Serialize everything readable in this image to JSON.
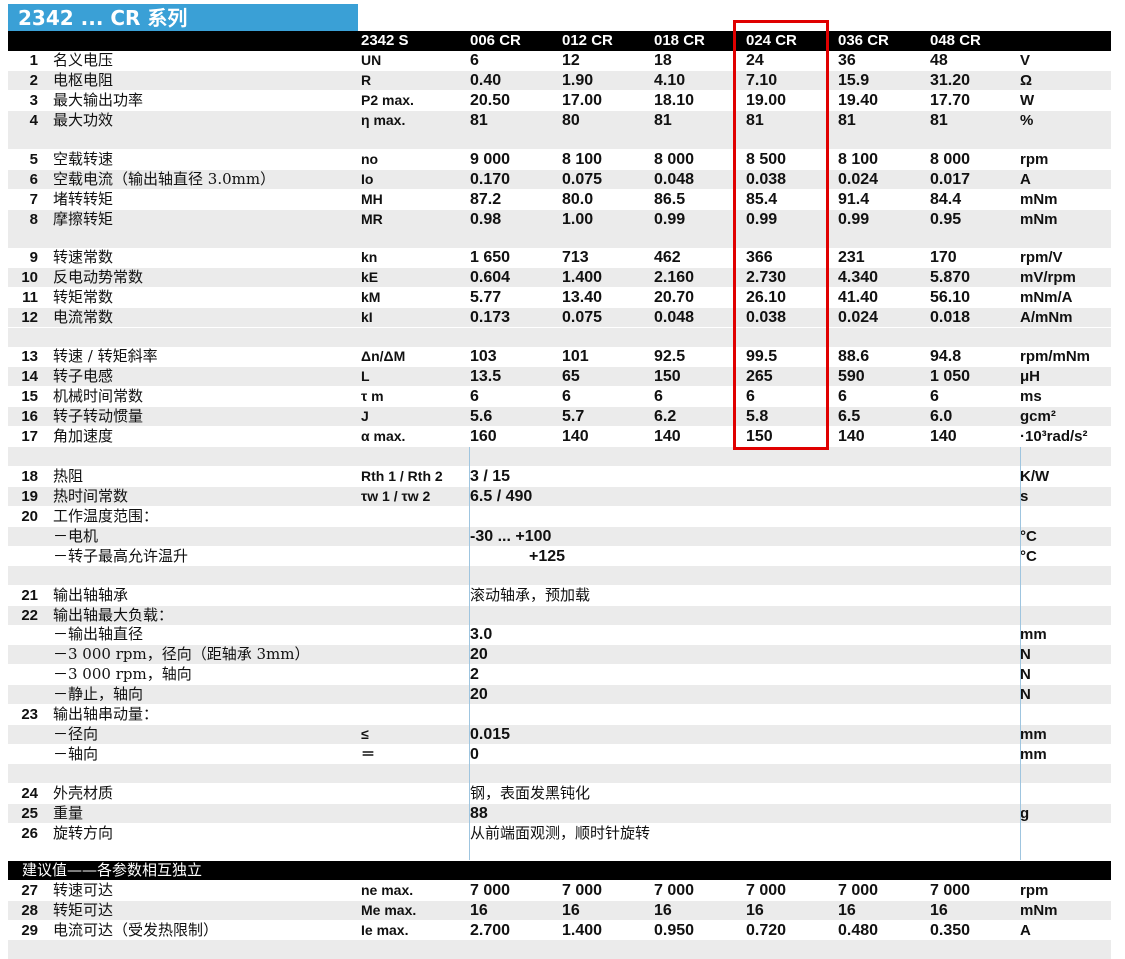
{
  "title": "2342 ... CR 系列",
  "headers": [
    "2342 S",
    "006 CR",
    "012 CR",
    "018 CR",
    "024 CR",
    "036 CR",
    "048 CR"
  ],
  "spec_rows": [
    {
      "num": "1",
      "label": "名义电压",
      "sym": "UN",
      "vals": [
        "6",
        "12",
        "18",
        "24",
        "36",
        "48"
      ],
      "unit": "V"
    },
    {
      "num": "2",
      "label": "电枢电阻",
      "sym": "R",
      "vals": [
        "0.40",
        "1.90",
        "4.10",
        "7.10",
        "15.9",
        "31.20"
      ],
      "unit": "Ω"
    },
    {
      "num": "3",
      "label": "最大输出功率",
      "sym": "P2 max.",
      "vals": [
        "20.50",
        "17.00",
        "18.10",
        "19.00",
        "19.40",
        "17.70"
      ],
      "unit": "W"
    },
    {
      "num": "4",
      "label": "最大功效",
      "sym": "η max.",
      "vals": [
        "81",
        "80",
        "81",
        "81",
        "81",
        "81"
      ],
      "unit": "%"
    },
    {
      "num": "5",
      "label": "空载转速",
      "sym": "no",
      "vals": [
        "9 000",
        "8 100",
        "8 000",
        "8 500",
        "8 100",
        "8 000"
      ],
      "unit": "rpm"
    },
    {
      "num": "6",
      "label": "空载电流（输出轴直径 3.0mm）",
      "sym": "Io",
      "vals": [
        "0.170",
        "0.075",
        "0.048",
        "0.038",
        "0.024",
        "0.017"
      ],
      "unit": "A"
    },
    {
      "num": "7",
      "label": "堵转转矩",
      "sym": "MH",
      "vals": [
        "87.2",
        "80.0",
        "86.5",
        "85.4",
        "91.4",
        "84.4"
      ],
      "unit": "mNm"
    },
    {
      "num": "8",
      "label": "摩擦转矩",
      "sym": "MR",
      "vals": [
        "0.98",
        "1.00",
        "0.99",
        "0.99",
        "0.99",
        "0.95"
      ],
      "unit": "mNm"
    },
    {
      "num": "9",
      "label": "转速常数",
      "sym": "kn",
      "vals": [
        "1 650",
        "713",
        "462",
        "366",
        "231",
        "170"
      ],
      "unit": "rpm/V"
    },
    {
      "num": "10",
      "label": "反电动势常数",
      "sym": "kE",
      "vals": [
        "0.604",
        "1.400",
        "2.160",
        "2.730",
        "4.340",
        "5.870"
      ],
      "unit": "mV/rpm"
    },
    {
      "num": "11",
      "label": "转矩常数",
      "sym": "kM",
      "vals": [
        "5.77",
        "13.40",
        "20.70",
        "26.10",
        "41.40",
        "56.10"
      ],
      "unit": "mNm/A"
    },
    {
      "num": "12",
      "label": "电流常数",
      "sym": "kI",
      "vals": [
        "0.173",
        "0.075",
        "0.048",
        "0.038",
        "0.024",
        "0.018"
      ],
      "unit": "A/mNm"
    },
    {
      "num": "13",
      "label": "转速 / 转矩斜率",
      "sym": "Δn/ΔM",
      "vals": [
        "103",
        "101",
        "92.5",
        "99.5",
        "88.6",
        "94.8"
      ],
      "unit": "rpm/mNm"
    },
    {
      "num": "14",
      "label": "转子电感",
      "sym": "L",
      "vals": [
        "13.5",
        "65",
        "150",
        "265",
        "590",
        "1 050"
      ],
      "unit": "μH"
    },
    {
      "num": "15",
      "label": "机械时间常数",
      "sym": "τ m",
      "vals": [
        "6",
        "6",
        "6",
        "6",
        "6",
        "6"
      ],
      "unit": "ms"
    },
    {
      "num": "16",
      "label": "转子转动惯量",
      "sym": "J",
      "vals": [
        "5.6",
        "5.7",
        "6.2",
        "5.8",
        "6.5",
        "6.0"
      ],
      "unit": "gcm²"
    },
    {
      "num": "17",
      "label": "角加速度",
      "sym": "α max.",
      "vals": [
        "160",
        "140",
        "140",
        "150",
        "140",
        "140"
      ],
      "unit": "·10³rad/s²"
    }
  ],
  "thermal_rows": [
    {
      "num": "18",
      "label": "热阻",
      "sym": "Rth 1 / Rth 2",
      "val": "3 / 15",
      "unit": "K/W"
    },
    {
      "num": "19",
      "label": "热时间常数",
      "sym": "τw 1 / τw 2",
      "val": "6.5 / 490",
      "unit": "s"
    },
    {
      "num": "20",
      "label": "工作温度范围：",
      "sym": "",
      "val": "",
      "unit": ""
    },
    {
      "num": "",
      "label": "－电机",
      "sym": "",
      "val": "-30 ... +100",
      "unit": "°C"
    },
    {
      "num": "",
      "label": "－转子最高允许温升",
      "sym": "",
      "val": "+125",
      "unit": "°C"
    }
  ],
  "mech_rows": [
    {
      "num": "21",
      "label": "输出轴轴承",
      "sym": "",
      "val": "滚动轴承，预加载",
      "unit": ""
    },
    {
      "num": "22",
      "label": "输出轴最大负载：",
      "sym": "",
      "val": "",
      "unit": ""
    },
    {
      "num": "",
      "label": "－输出轴直径",
      "sym": "",
      "val": "3.0",
      "unit": "mm"
    },
    {
      "num": "",
      "label": "－3 000 rpm，径向（距轴承 3mm）",
      "sym": "",
      "val": "20",
      "unit": "N"
    },
    {
      "num": "",
      "label": "－3 000 rpm，轴向",
      "sym": "",
      "val": "2",
      "unit": "N"
    },
    {
      "num": "",
      "label": "－静止，轴向",
      "sym": "",
      "val": "20",
      "unit": "N"
    },
    {
      "num": "23",
      "label": "输出轴串动量：",
      "sym": "",
      "val": "",
      "unit": ""
    },
    {
      "num": "",
      "label": "－径向",
      "sym": "≤",
      "val": "0.015",
      "unit": "mm"
    },
    {
      "num": "",
      "label": "－轴向",
      "sym": "＝",
      "val": "0",
      "unit": "mm"
    }
  ],
  "misc_rows": [
    {
      "num": "24",
      "label": "外壳材质",
      "sym": "",
      "val": "钢，表面发黑钝化",
      "unit": ""
    },
    {
      "num": "25",
      "label": "重量",
      "sym": "",
      "val": "88",
      "unit": "g"
    },
    {
      "num": "26",
      "label": "旋转方向",
      "sym": "",
      "val": "从前端面观测，顺时针旋转",
      "unit": ""
    }
  ],
  "recommended_header": "建议值——各参数相互独立",
  "recommended_rows": [
    {
      "num": "27",
      "label": "转速可达",
      "sym": "ne max.",
      "vals": [
        "7 000",
        "7 000",
        "7 000",
        "7 000",
        "7 000",
        "7 000"
      ],
      "unit": "rpm"
    },
    {
      "num": "28",
      "label": "转矩可达",
      "sym": "Me max.",
      "vals": [
        "16",
        "16",
        "16",
        "16",
        "16",
        "16"
      ],
      "unit": "mNm"
    },
    {
      "num": "29",
      "label": "电流可达（受发热限制）",
      "sym": "Ie max.",
      "vals": [
        "2.700",
        "1.400",
        "0.950",
        "0.720",
        "0.480",
        "0.350"
      ],
      "unit": "A"
    }
  ],
  "highlighted_column": "024 CR",
  "colors": {
    "title_bg": "#3aa0d6",
    "header_bg": "#000000",
    "stripe": "#ebebeb",
    "highlight": "#e00000",
    "grid": "#9fc5df"
  }
}
